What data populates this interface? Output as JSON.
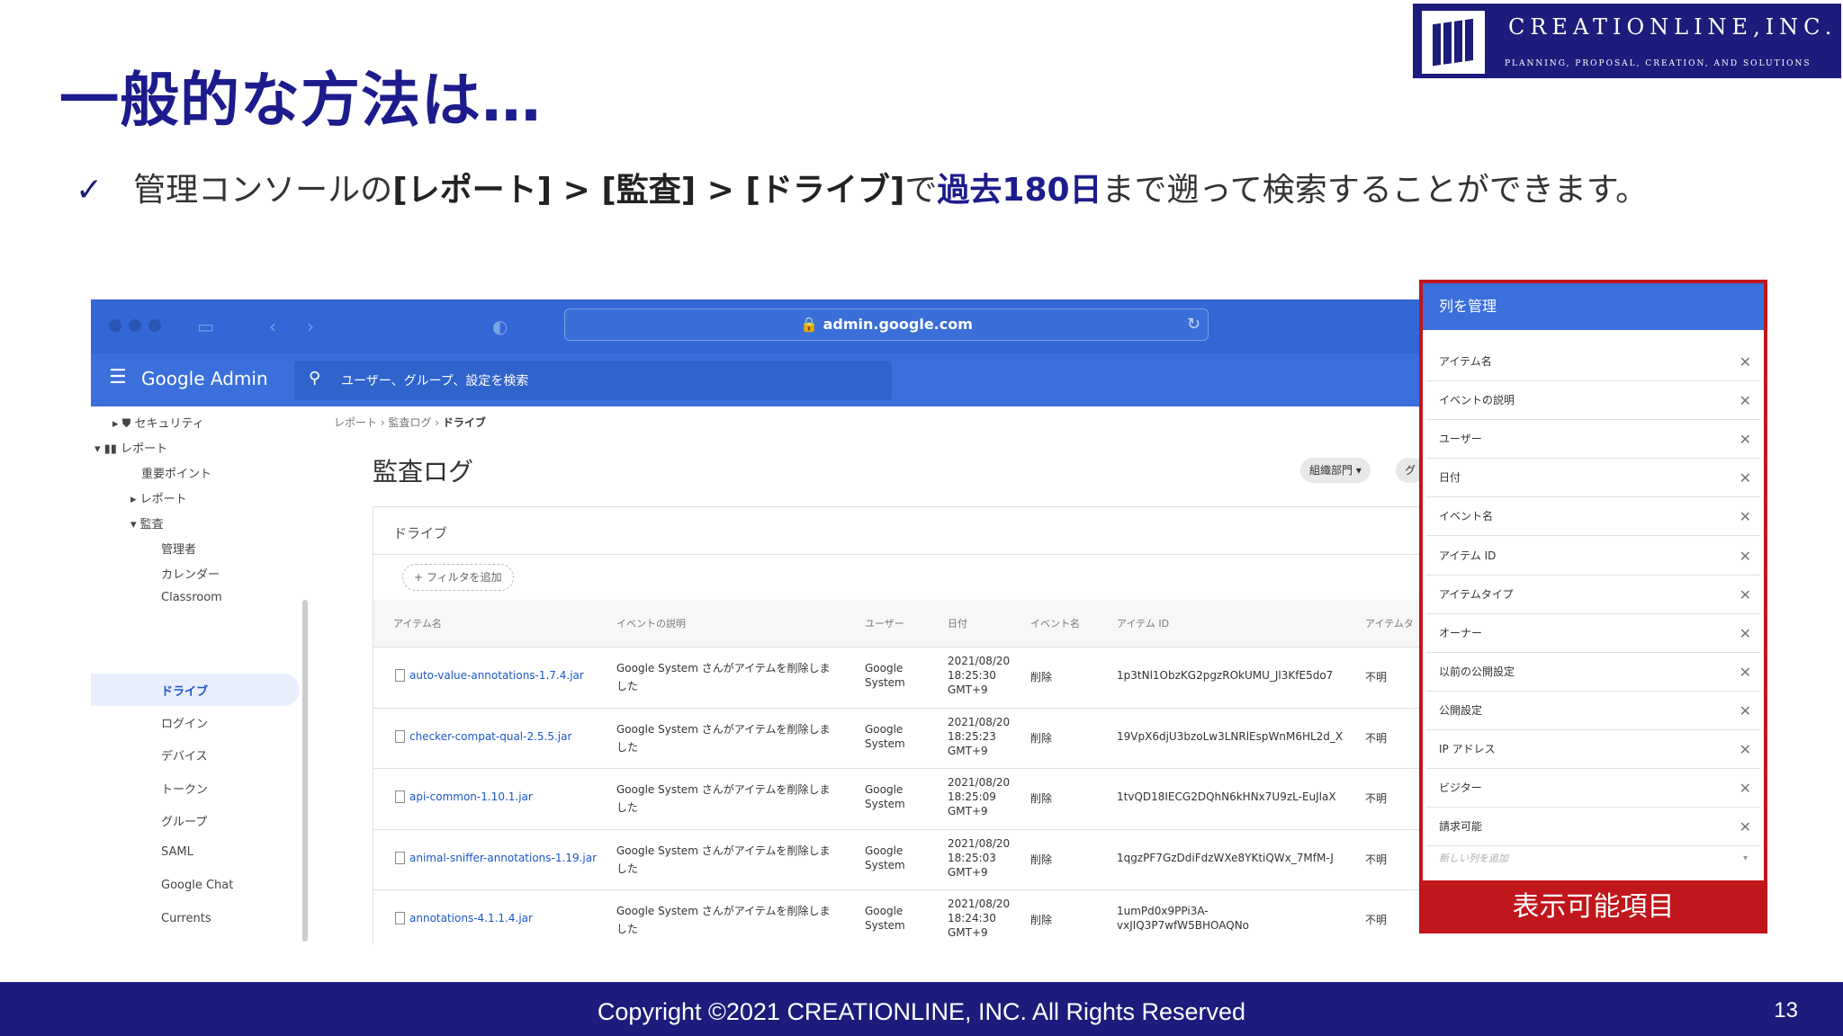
{
  "slide": {
    "title": "一般的な方法は…",
    "bullet_check": "✓",
    "bullet_parts": [
      "管理コンソールの",
      "[レポート] > [監査] > [ドライブ]",
      "で",
      "過去180日",
      "まで遡って検索することができます。"
    ]
  },
  "logo": {
    "name": "CREATIONLINE,INC.",
    "tagline": "PLANNING, PROPOSAL, CREATION, AND SOLUTIONS"
  },
  "browser": {
    "url": "🔒 admin.google.com",
    "reload": "↻"
  },
  "app": {
    "name": "Google Admin",
    "search_placeholder": "ユーザー、グループ、設定を検索"
  },
  "sidebar": {
    "items": [
      "セキュリティ",
      "レポート",
      "重要ポイント",
      "レポート",
      "監査",
      "管理者",
      "カレンダー",
      "Classroom",
      "ドライブ",
      "ログイン",
      "デバイス",
      "トークン",
      "グループ",
      "SAML",
      "Google Chat",
      "Currents"
    ]
  },
  "breadcrumb": {
    "a": "レポート",
    "b": "監査ログ",
    "c": "ドライブ"
  },
  "page": {
    "title": "監査ログ",
    "chip_org": "組織部門 ▾",
    "chip_group": "グ"
  },
  "card": {
    "title": "ドライブ",
    "add_filter": "+ フィルタを追加",
    "headers": [
      "アイテム名",
      "イベントの説明",
      "ユーザー",
      "日付",
      "イベント名",
      "アイテム ID",
      "アイテムタ"
    ],
    "rows": [
      {
        "name": "auto-value-annotations-1.7.4.jar",
        "desc1": "Google System さんがアイテムを削除しま",
        "desc2": "した",
        "user1": "Google",
        "user2": "System",
        "d1": "2021/08/20",
        "d2": "18:25:30",
        "d3": "GMT+9",
        "event": "削除",
        "id1": "1p3tNl1ObzKG2pgzROkUMU_Jl3KfE5do7",
        "id2": "",
        "type": "不明"
      },
      {
        "name": "checker-compat-qual-2.5.5.jar",
        "desc1": "Google System さんがアイテムを削除しま",
        "desc2": "した",
        "user1": "Google",
        "user2": "System",
        "d1": "2021/08/20",
        "d2": "18:25:23",
        "d3": "GMT+9",
        "event": "削除",
        "id1": "19VpX6djU3bzoLw3LNRlEspWnM6HL2d_X",
        "id2": "",
        "type": "不明"
      },
      {
        "name": "api-common-1.10.1.jar",
        "desc1": "Google System さんがアイテムを削除しま",
        "desc2": "した",
        "user1": "Google",
        "user2": "System",
        "d1": "2021/08/20",
        "d2": "18:25:09",
        "d3": "GMT+9",
        "event": "削除",
        "id1": "1tvQD18IECG2DQhN6kHNx7U9zL-EuJlaX",
        "id2": "",
        "type": "不明"
      },
      {
        "name": "animal-sniffer-annotations-1.19.jar",
        "desc1": "Google System さんがアイテムを削除しま",
        "desc2": "した",
        "user1": "Google",
        "user2": "System",
        "d1": "2021/08/20",
        "d2": "18:25:03",
        "d3": "GMT+9",
        "event": "削除",
        "id1": "1qgzPF7GzDdiFdzWXe8YKtiQWx_7MfM-J",
        "id2": "",
        "type": "不明"
      },
      {
        "name": "annotations-4.1.1.4.jar",
        "desc1": "Google System さんがアイテムを削除しま",
        "desc2": "した",
        "user1": "Google",
        "user2": "System",
        "d1": "2021/08/20",
        "d2": "18:24:30",
        "d3": "GMT+9",
        "event": "削除",
        "id1": "1umPd0x9PPi3A-",
        "id2": "vxJIQ3P7wfW5BHOAQNo",
        "type": "不明"
      }
    ]
  },
  "panel": {
    "title": "列を管理",
    "columns": [
      "アイテム名",
      "イベントの説明",
      "ユーザー",
      "日付",
      "イベント名",
      "アイテム ID",
      "アイテムタイプ",
      "オーナー",
      "以前の公開設定",
      "公開設定",
      "IP アドレス",
      "ビジター",
      "請求可能"
    ],
    "remove": "✕",
    "add_placeholder": "新しい列を追加",
    "add_dropdown": "▾",
    "label": "表示可能項目"
  },
  "footer": {
    "copyright": "Copyright ©2021 CREATIONLINE, INC. All Rights Reserved",
    "page": "13"
  },
  "colors": {
    "navy": "#1c1c7c",
    "google_blue": "#3b6fdc",
    "highlight_red": "#c0161c"
  }
}
